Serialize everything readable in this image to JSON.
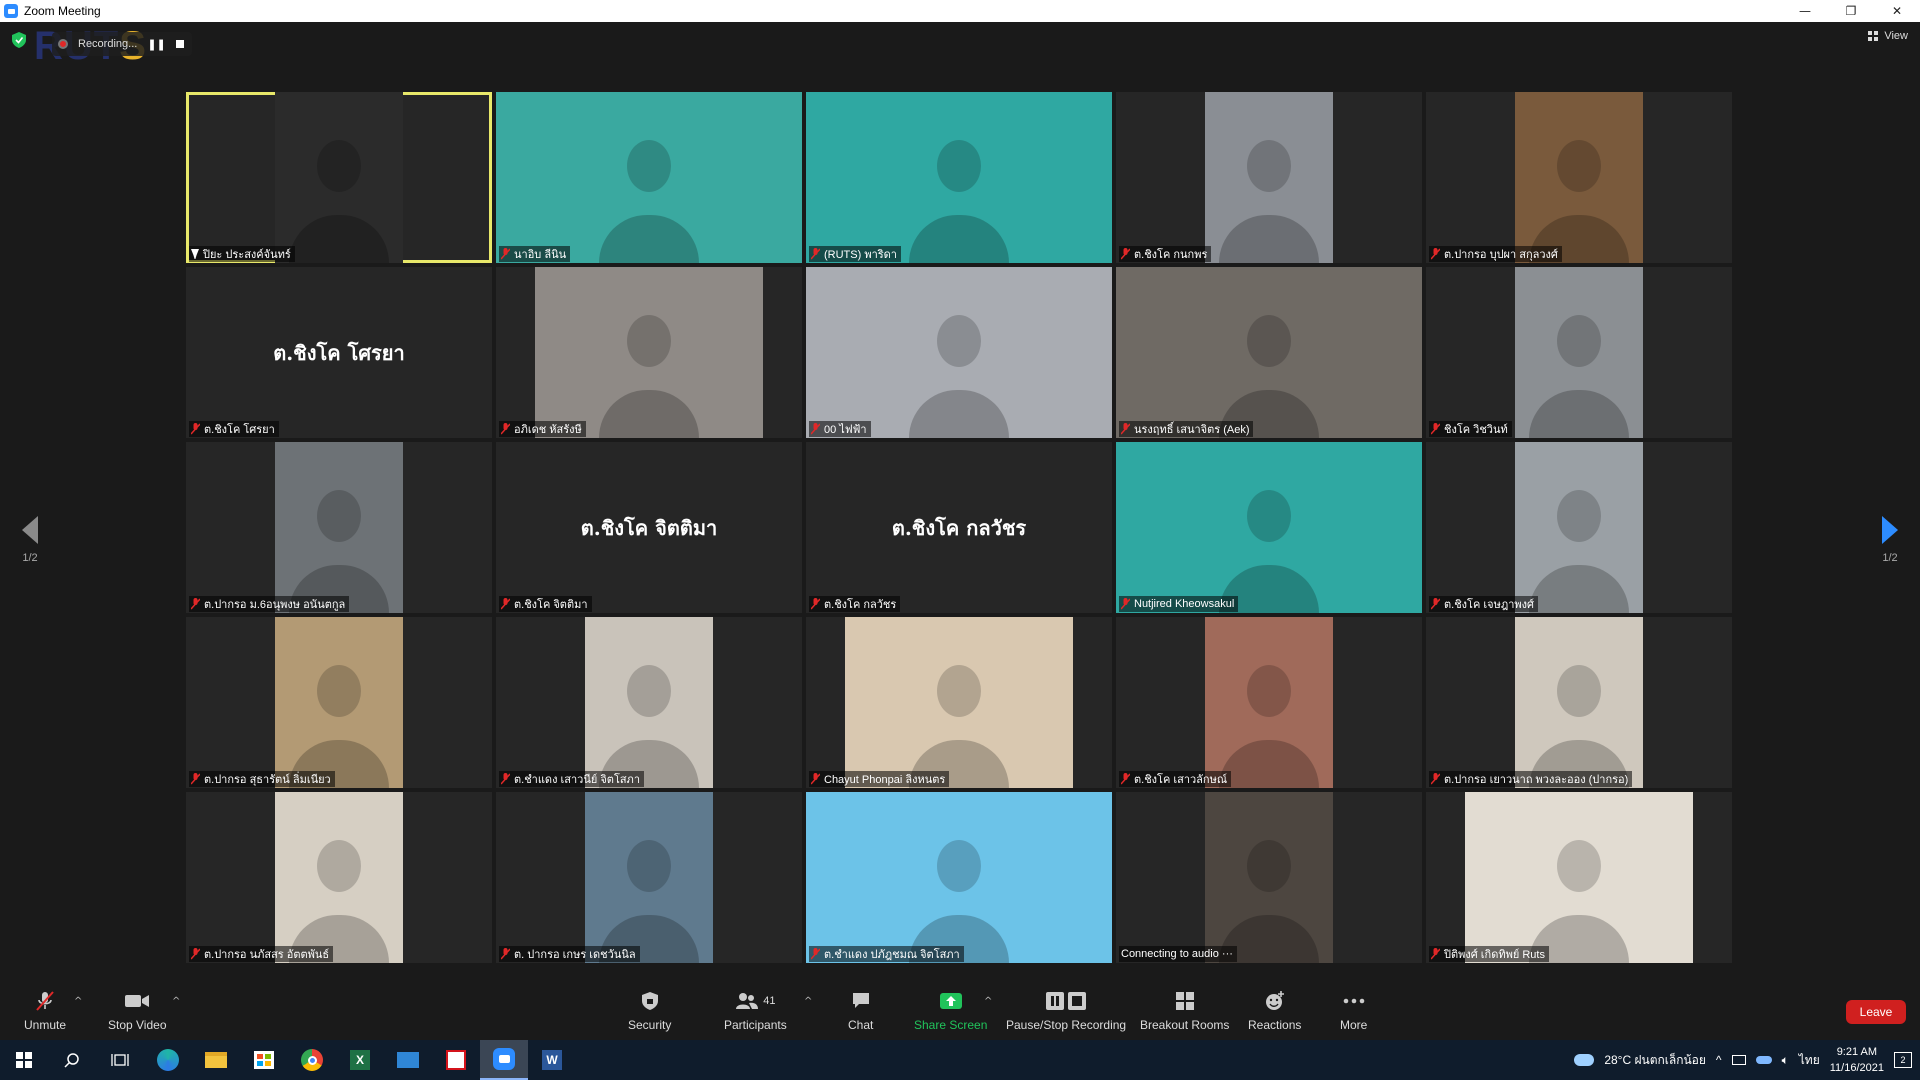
{
  "window": {
    "title": "Zoom Meeting",
    "controls": {
      "minimize": "—",
      "restore": "❐",
      "close": "✕"
    }
  },
  "top": {
    "logo_main": "RUT",
    "logo_accent": "S",
    "recording_label": "Recording...",
    "view_label": "View"
  },
  "pager": {
    "left_label": "1/2",
    "right_label": "1/2"
  },
  "participants": [
    {
      "label": "ปิยะ ประสงค์จันทร์",
      "kind": "video",
      "video": "mid",
      "tone": "#2b2b2b",
      "active": true,
      "muted": false
    },
    {
      "label": "นาอิบ ลีนิน",
      "kind": "video",
      "video": "wide",
      "tone": "#3aa9a0",
      "active": false,
      "muted": true
    },
    {
      "label": "(RUTS) พาริดา",
      "kind": "video",
      "video": "wide",
      "tone": "#2fa8a2",
      "active": false,
      "muted": true
    },
    {
      "label": "ต.ชิงโค กนกพร",
      "kind": "video",
      "video": "mid",
      "tone": "#8a8e94",
      "active": false,
      "muted": true
    },
    {
      "label": "ต.ปากรอ บุปผา สกุลวงศ์",
      "kind": "video",
      "video": "mid",
      "tone": "#7a5a3c",
      "active": false,
      "muted": true
    },
    {
      "label": "ต.ชิงโค โศรยา",
      "kind": "name",
      "display_name": "ต.ชิงโค โศรยา",
      "active": false,
      "muted": true
    },
    {
      "label": "อภิเดช หัสรังษี",
      "kind": "video",
      "video": "midwide",
      "tone": "#8f8a86",
      "active": false,
      "muted": true
    },
    {
      "label": "00 ไฟฟ้า",
      "kind": "video",
      "video": "wide",
      "tone": "#a9acb2",
      "active": false,
      "muted": true
    },
    {
      "label": "นรงฤทธิ์ เสนาจิตร (Aek)",
      "kind": "video",
      "video": "wide",
      "tone": "#6f6a64",
      "active": false,
      "muted": true
    },
    {
      "label": "ชิงโค วิชวินท์",
      "kind": "video",
      "video": "mid",
      "tone": "#8b8f93",
      "active": false,
      "muted": true
    },
    {
      "label": "ต.ปากรอ ม.6อนุพงษ อนันตกูล",
      "kind": "video",
      "video": "mid",
      "tone": "#6d7276",
      "active": false,
      "muted": true
    },
    {
      "label": "ต.ชิงโค จิตติมา",
      "kind": "name",
      "display_name": "ต.ชิงโค จิตติมา",
      "active": false,
      "muted": true
    },
    {
      "label": "ต.ชิงโค กลวัชร",
      "kind": "name",
      "display_name": "ต.ชิงโค กลวัชร",
      "active": false,
      "muted": true
    },
    {
      "label": "Nutjired Kheowsakul",
      "kind": "video",
      "video": "wide",
      "tone": "#2fa8a2",
      "active": false,
      "muted": true
    },
    {
      "label": "ต.ชิงโค เจษฎาพงศ์",
      "kind": "video",
      "video": "mid",
      "tone": "#9aa0a5",
      "active": false,
      "muted": true
    },
    {
      "label": "ต.ปากรอ สุธารัตน์ ลิ่มเนียว",
      "kind": "video",
      "video": "mid",
      "tone": "#b39a74",
      "active": false,
      "muted": true
    },
    {
      "label": "ต.ชำแดง เสาวนีย์ จิตโสภา",
      "kind": "video",
      "video": "mid",
      "tone": "#c9c3ba",
      "active": false,
      "muted": true
    },
    {
      "label": "Chayut Phonpai ลิงหนตร",
      "kind": "video",
      "video": "midwide",
      "tone": "#d9c8b0",
      "active": false,
      "muted": true
    },
    {
      "label": "ต.ชิงโค เสาวลักษณ์",
      "kind": "video",
      "video": "mid",
      "tone": "#a06a5a",
      "active": false,
      "muted": true
    },
    {
      "label": "ต.ปากรอ เยาวนาถ พวงละออง (ปากรอ)",
      "kind": "video",
      "video": "mid",
      "tone": "#cfc8bd",
      "active": false,
      "muted": true
    },
    {
      "label": "ต.ปากรอ นภัสสร อัตตพันธ์",
      "kind": "video",
      "video": "mid",
      "tone": "#d6cfc3",
      "active": false,
      "muted": true
    },
    {
      "label": "ต. ปากรอ เกษร เดชวันนิล",
      "kind": "video",
      "video": "mid",
      "tone": "#5f7a8e",
      "active": false,
      "muted": true
    },
    {
      "label": "ต.ชำแดง ปภัฎชมณ จิตโสภา",
      "kind": "video",
      "video": "wide",
      "tone": "#6cc3e8",
      "active": false,
      "muted": true
    },
    {
      "label": "Connecting to audio ···",
      "kind": "video",
      "video": "mid",
      "tone": "#4d4640",
      "active": false,
      "muted": false
    },
    {
      "label": "ปิติพงศ์ เกิดทิพย์ Ruts",
      "kind": "video",
      "video": "midwide",
      "tone": "#e2dcd2",
      "active": false,
      "muted": true
    }
  ],
  "toolbar": {
    "unmute": "Unmute",
    "stop_video": "Stop Video",
    "security": "Security",
    "participants": "Participants",
    "participants_count": "41",
    "chat": "Chat",
    "share_screen": "Share Screen",
    "pause_stop_recording": "Pause/Stop Recording",
    "breakout_rooms": "Breakout Rooms",
    "reactions": "Reactions",
    "more": "More",
    "leave": "Leave"
  },
  "taskbar": {
    "weather": "28°C  ฝนตกเล็กน้อย",
    "lang": "ไทย",
    "time": "9:21 AM",
    "date": "11/16/2021",
    "notifications": "2"
  },
  "colors": {
    "active_speaker": "#e8e86a",
    "share_green": "#21c35b",
    "leave_red": "#d0201f",
    "zoom_blue": "#2d8cff"
  }
}
